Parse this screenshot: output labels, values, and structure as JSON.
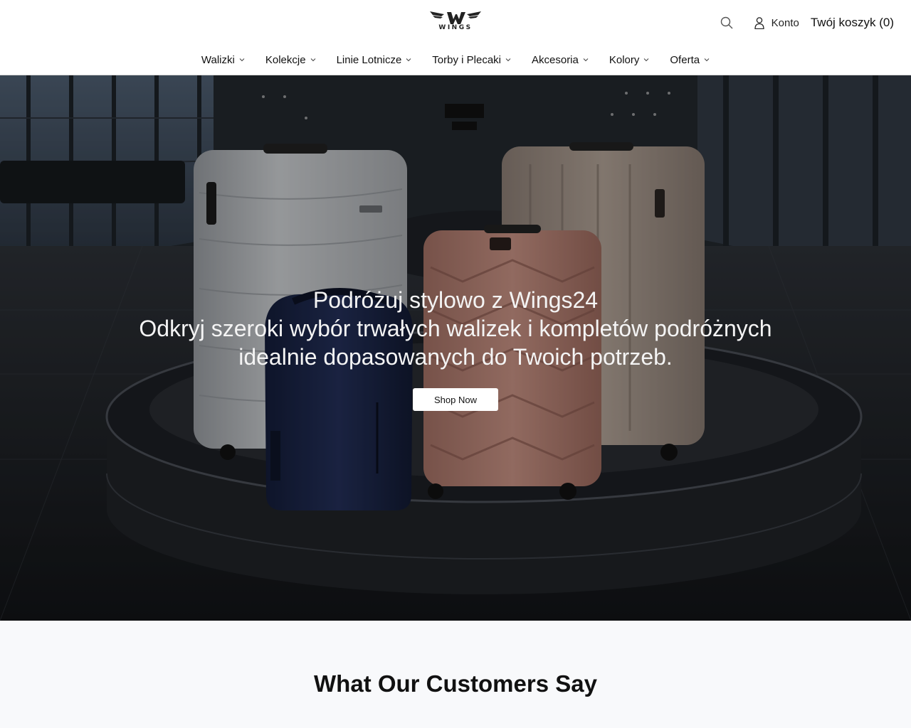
{
  "header": {
    "logo_text": "WINGS",
    "account_label": "Konto",
    "cart_label": "Twój koszyk (0)"
  },
  "icons": {
    "search": "search-icon",
    "account": "user-icon",
    "chevron": "chevron-down-icon",
    "logo": "wings-logo"
  },
  "nav": {
    "items": [
      {
        "label": "Walizki"
      },
      {
        "label": "Kolekcje"
      },
      {
        "label": "Linie Lotnicze"
      },
      {
        "label": "Torby i Plecaki"
      },
      {
        "label": "Akcesoria"
      },
      {
        "label": "Kolory"
      },
      {
        "label": "Oferta"
      }
    ]
  },
  "hero": {
    "title": "Podróżuj stylowo z Wings24",
    "subtitle": "Odkryj szeroki wybór trwałych walizek i kompletów podróżnych idealnie dopasowanych do Twoich potrzeb.",
    "cta_label": "Shop Now"
  },
  "testimonials": {
    "title": "What Our Customers Say"
  },
  "colors": {
    "accent": "#111111",
    "hero_bg": "#1c2228",
    "section_bg": "#f8f9fb"
  }
}
